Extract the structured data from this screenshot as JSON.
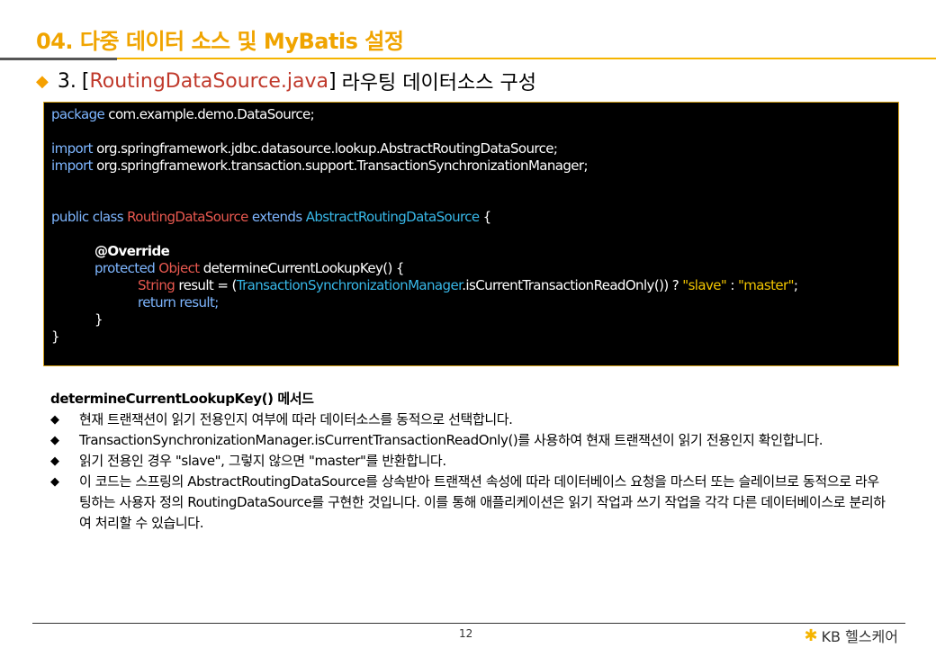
{
  "header": {
    "title": "04. 다중 데이터 소스 및 MyBatis 설정"
  },
  "section": {
    "number": "3.",
    "open": "[",
    "file": "RoutingDataSource.java",
    "close": "]",
    "suffix": "라우팅 데이터소스 구성"
  },
  "code": {
    "kw_package": "package",
    "package_name": " com.example.demo.DataSource;",
    "kw_import": "import",
    "import1": " org.springframework.jdbc.datasource.lookup.AbstractRoutingDataSource;",
    "import2": " org.springframework.transaction.support.TransactionSynchronizationManager;",
    "class_prefix": "public class ",
    "class_name": "RoutingDataSource",
    "extends_word": " extends ",
    "parent_class": "AbstractRoutingDataSource",
    "open_brace": " {",
    "annotation": "@Override",
    "protected_word": "protected ",
    "object_type": "Object",
    "method_sig": " determineCurrentLookupKey() {",
    "string_type": "String",
    "result_assign": " result = (",
    "tsm": "TransactionSynchronizationManager",
    "tsm_call": ".isCurrentTransactionReadOnly()) ? ",
    "slave": "\"slave\"",
    "colon": " : ",
    "master": "\"master\"",
    "semicolon": ";",
    "return_line": "return result;",
    "close_method": "}",
    "close_class": "}"
  },
  "explanation": {
    "heading": "determineCurrentLookupKey() 메서드",
    "bullets": [
      "현재 트랜잭션이 읽기 전용인지 여부에 따라 데이터소스를 동적으로 선택합니다.",
      "TransactionSynchronizationManager.isCurrentTransactionReadOnly()를 사용하여 현재 트랜잭션이 읽기 전용인지 확인합니다.",
      "읽기 전용인 경우 \"slave\", 그렇지 않으면 \"master\"를 반환합니다.",
      "이 코드는 스프링의 AbstractRoutingDataSource를 상속받아 트랜잭션 속성에 따라 데이터베이스 요청을 마스터 또는 슬레이브로 동적으로 라우팅하는 사용자 정의 RoutingDataSource를 구현한 것입니다. 이를 통해 애플리케이션은 읽기 작업과 쓰기 작업을 각각 다른 데이터베이스로 분리하여 처리할 수 있습니다."
    ],
    "bullet_mark": "◆"
  },
  "footer": {
    "page": "12",
    "logo_text": "KB 헬스케어",
    "logo_mark": "✱"
  },
  "colors": {
    "accent": "#f0a400",
    "file": "#c0392b"
  }
}
